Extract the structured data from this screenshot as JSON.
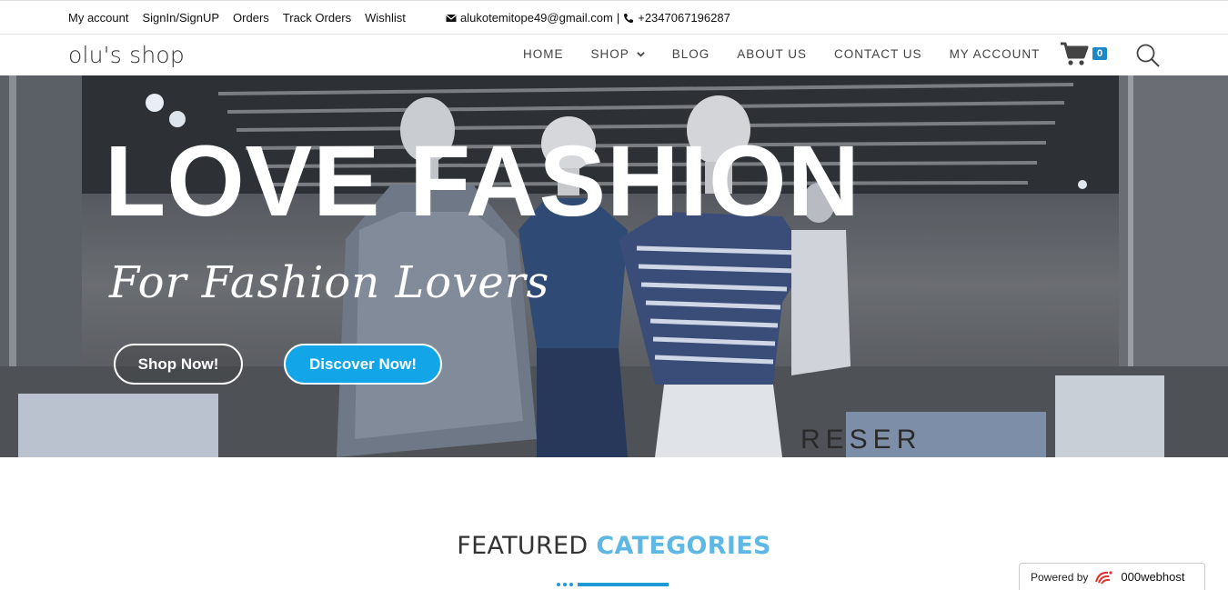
{
  "topbar": {
    "links": [
      "My account",
      "SignIn/SignUP",
      "Orders",
      "Track Orders",
      "Wishlist"
    ],
    "email": "alukotemitope49@gmail.com",
    "separator": "|",
    "phone": "+2347067196287"
  },
  "brand": "olu's shop",
  "nav": {
    "items": [
      "HOME",
      "SHOP",
      "BLOG",
      "ABOUT US",
      "CONTACT US",
      "MY ACCOUNT"
    ]
  },
  "cart": {
    "count": "0"
  },
  "hero": {
    "title": "LOVE FASHION",
    "subtitle": "For Fashion Lovers",
    "shop_button": "Shop Now!",
    "discover_button": "Discover Now!",
    "sign_text": "RESER"
  },
  "featured": {
    "part1": "FEATURED",
    "part2": "CATEGORIES"
  },
  "powered": {
    "label": "Powered by",
    "brand": "000webhost"
  },
  "colors": {
    "accent": "#1e88c7",
    "primary_button": "#12a6e8",
    "heading_accent": "#5eb7e4"
  }
}
